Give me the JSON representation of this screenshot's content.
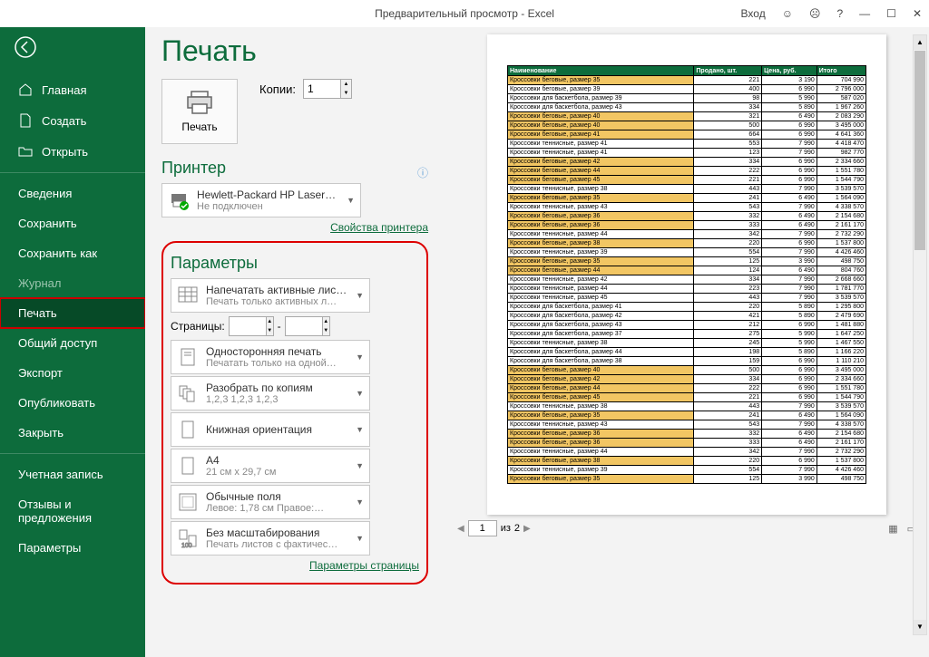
{
  "titlebar": {
    "title": "Предварительный просмотр  -  Excel",
    "signin": "Вход"
  },
  "sidebar": {
    "home": "Главная",
    "new": "Создать",
    "open": "Открыть",
    "info": "Сведения",
    "save": "Сохранить",
    "saveas": "Сохранить как",
    "history": "Журнал",
    "print": "Печать",
    "share": "Общий доступ",
    "export": "Экспорт",
    "publish": "Опубликовать",
    "close": "Закрыть",
    "account": "Учетная запись",
    "feedback": "Отзывы и предложения",
    "options": "Параметры"
  },
  "print": {
    "title": "Печать",
    "button": "Печать",
    "copies_label": "Копии:",
    "copies_value": "1"
  },
  "printer": {
    "heading": "Принтер",
    "name": "Hewlett-Packard HP LaserJe…",
    "status": "Не подключен",
    "properties_link": "Свойства принтера"
  },
  "settings": {
    "heading": "Параметры",
    "active_sheets": "Напечатать активные листы",
    "active_sheets_sub": "Печать только активных л…",
    "pages_label": "Страницы:",
    "to": "-",
    "one_sided": "Односторонняя печать",
    "one_sided_sub": "Печатать только на одной…",
    "collate": "Разобрать по копиям",
    "collate_sub": "1,2,3    1,2,3    1,2,3",
    "orientation": "Книжная ориентация",
    "paper": "A4",
    "paper_sub": "21 см x 29,7 см",
    "margins": "Обычные поля",
    "margins_sub": "Левое:  1,78 см    Правое:…",
    "scaling": "Без масштабирования",
    "scaling_sub": "Печать листов с фактичес…",
    "page_setup_link": "Параметры страницы"
  },
  "pager": {
    "current": "1",
    "of_label": "из",
    "total": "2"
  },
  "table": {
    "headers": [
      "Наименование",
      "Продано, шт.",
      "Цена, руб.",
      "Итого"
    ],
    "rows": [
      {
        "hl": true,
        "c": [
          "Кроссовки беговые, размер 35",
          "221",
          "3 190",
          "704 990"
        ]
      },
      {
        "hl": false,
        "c": [
          "Кроссовки беговые, размер 39",
          "400",
          "6 990",
          "2 796 000"
        ]
      },
      {
        "hl": false,
        "c": [
          "Кроссовки для баскетбола, размер 39",
          "98",
          "5 990",
          "587 020"
        ]
      },
      {
        "hl": false,
        "c": [
          "Кроссовки для баскетбола, размер 43",
          "334",
          "5 890",
          "1 967 260"
        ]
      },
      {
        "hl": true,
        "c": [
          "Кроссовки беговые, размер 40",
          "321",
          "6 490",
          "2 083 290"
        ]
      },
      {
        "hl": true,
        "c": [
          "Кроссовки беговые, размер 40",
          "500",
          "6 990",
          "3 495 000"
        ]
      },
      {
        "hl": true,
        "c": [
          "Кроссовки беговые, размер 41",
          "664",
          "6 990",
          "4 641 360"
        ]
      },
      {
        "hl": false,
        "c": [
          "Кроссовки теннисные, размер 41",
          "553",
          "7 990",
          "4 418 470"
        ]
      },
      {
        "hl": false,
        "c": [
          "Кроссовки теннисные, размер 41",
          "123",
          "7 990",
          "982 770"
        ]
      },
      {
        "hl": true,
        "c": [
          "Кроссовки беговые, размер 42",
          "334",
          "6 990",
          "2 334 660"
        ]
      },
      {
        "hl": true,
        "c": [
          "Кроссовки беговые, размер 44",
          "222",
          "6 990",
          "1 551 780"
        ]
      },
      {
        "hl": true,
        "c": [
          "Кроссовки беговые, размер 45",
          "221",
          "6 990",
          "1 544 790"
        ]
      },
      {
        "hl": false,
        "c": [
          "Кроссовки теннисные, размер 38",
          "443",
          "7 990",
          "3 539 570"
        ]
      },
      {
        "hl": true,
        "c": [
          "Кроссовки беговые, размер 35",
          "241",
          "6 490",
          "1 564 090"
        ]
      },
      {
        "hl": false,
        "c": [
          "Кроссовки теннисные, размер 43",
          "543",
          "7 990",
          "4 338 570"
        ]
      },
      {
        "hl": true,
        "c": [
          "Кроссовки беговые, размер 36",
          "332",
          "6 490",
          "2 154 680"
        ]
      },
      {
        "hl": true,
        "c": [
          "Кроссовки беговые, размер 36",
          "333",
          "6 490",
          "2 161 170"
        ]
      },
      {
        "hl": false,
        "c": [
          "Кроссовки теннисные, размер 44",
          "342",
          "7 990",
          "2 732 290"
        ]
      },
      {
        "hl": true,
        "c": [
          "Кроссовки беговые, размер 38",
          "220",
          "6 990",
          "1 537 800"
        ]
      },
      {
        "hl": false,
        "c": [
          "Кроссовки теннисные, размер 39",
          "554",
          "7 990",
          "4 426 460"
        ]
      },
      {
        "hl": true,
        "c": [
          "Кроссовки беговые, размер 35",
          "125",
          "3 990",
          "498 750"
        ]
      },
      {
        "hl": true,
        "c": [
          "Кроссовки беговые, размер 44",
          "124",
          "6 490",
          "804 760"
        ]
      },
      {
        "hl": false,
        "c": [
          "Кроссовки теннисные, размер 42",
          "334",
          "7 990",
          "2 668 660"
        ]
      },
      {
        "hl": false,
        "c": [
          "Кроссовки теннисные, размер 44",
          "223",
          "7 990",
          "1 781 770"
        ]
      },
      {
        "hl": false,
        "c": [
          "Кроссовки теннисные, размер 45",
          "443",
          "7 990",
          "3 539 570"
        ]
      },
      {
        "hl": false,
        "c": [
          "Кроссовки для баскетбола, размер 41",
          "220",
          "5 890",
          "1 295 800"
        ]
      },
      {
        "hl": false,
        "c": [
          "Кроссовки для баскетбола, размер 42",
          "421",
          "5 890",
          "2 479 690"
        ]
      },
      {
        "hl": false,
        "c": [
          "Кроссовки для баскетбола, размер 43",
          "212",
          "6 990",
          "1 481 880"
        ]
      },
      {
        "hl": false,
        "c": [
          "Кроссовки для баскетбола, размер 37",
          "275",
          "5 990",
          "1 647 250"
        ]
      },
      {
        "hl": false,
        "c": [
          "Кроссовки теннисные, размер 38",
          "245",
          "5 990",
          "1 467 550"
        ]
      },
      {
        "hl": false,
        "c": [
          "Кроссовки для баскетбола, размер 44",
          "198",
          "5 890",
          "1 166 220"
        ]
      },
      {
        "hl": false,
        "c": [
          "Кроссовки для баскетбола, размер 38",
          "159",
          "6 990",
          "1 110 210"
        ]
      },
      {
        "hl": true,
        "c": [
          "Кроссовки беговые, размер 40",
          "500",
          "6 990",
          "3 495 000"
        ]
      },
      {
        "hl": true,
        "c": [
          "Кроссовки беговые, размер 42",
          "334",
          "6 990",
          "2 334 660"
        ]
      },
      {
        "hl": true,
        "c": [
          "Кроссовки беговые, размер 44",
          "222",
          "6 990",
          "1 551 780"
        ]
      },
      {
        "hl": true,
        "c": [
          "Кроссовки беговые, размер 45",
          "221",
          "6 990",
          "1 544 790"
        ]
      },
      {
        "hl": false,
        "c": [
          "Кроссовки теннисные, размер 38",
          "443",
          "7 990",
          "3 539 570"
        ]
      },
      {
        "hl": true,
        "c": [
          "Кроссовки беговые, размер 35",
          "241",
          "6 490",
          "1 564 090"
        ]
      },
      {
        "hl": false,
        "c": [
          "Кроссовки теннисные, размер 43",
          "543",
          "7 990",
          "4 338 570"
        ]
      },
      {
        "hl": true,
        "c": [
          "Кроссовки беговые, размер 36",
          "332",
          "6 490",
          "2 154 680"
        ]
      },
      {
        "hl": true,
        "c": [
          "Кроссовки беговые, размер 36",
          "333",
          "6 490",
          "2 161 170"
        ]
      },
      {
        "hl": false,
        "c": [
          "Кроссовки теннисные, размер 44",
          "342",
          "7 990",
          "2 732 290"
        ]
      },
      {
        "hl": true,
        "c": [
          "Кроссовки беговые, размер 38",
          "220",
          "6 990",
          "1 537 800"
        ]
      },
      {
        "hl": false,
        "c": [
          "Кроссовки теннисные, размер 39",
          "554",
          "7 990",
          "4 426 460"
        ]
      },
      {
        "hl": true,
        "c": [
          "Кроссовки беговые, размер 35",
          "125",
          "3 990",
          "498 750"
        ]
      }
    ]
  }
}
